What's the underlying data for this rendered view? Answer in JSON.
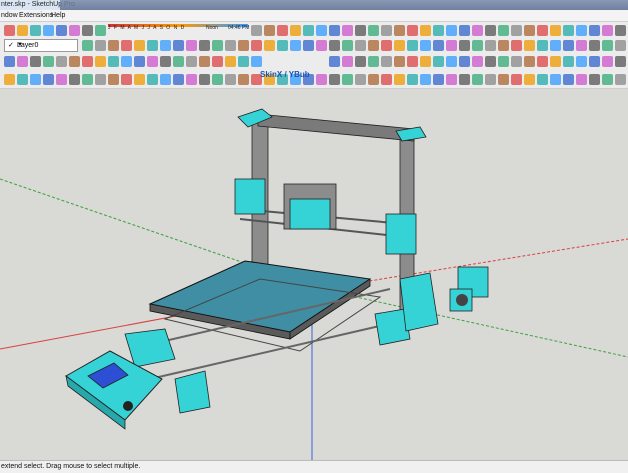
{
  "window": {
    "title": "nter.skp - SketchUp Pro"
  },
  "menu": {
    "items": [
      "ndow",
      "Extensions",
      "Help"
    ]
  },
  "toolbar": {
    "shadow_months": "J F M A M J J A S O N D",
    "shadow_noon": "Noon",
    "shadow_time": "04:46 PM",
    "layer_current": "Layer0",
    "plugin_label": "SkinX / YBub"
  },
  "status": {
    "text": "extend select. Drag mouse to select multiple."
  },
  "colors": {
    "model_cyan": "#35d3d6",
    "frame_gray": "#8c8c8c",
    "bed_blue": "#3f8ea3",
    "axis_red": "#d94040",
    "axis_green": "#3da33d",
    "axis_blue": "#3f5fd6"
  }
}
